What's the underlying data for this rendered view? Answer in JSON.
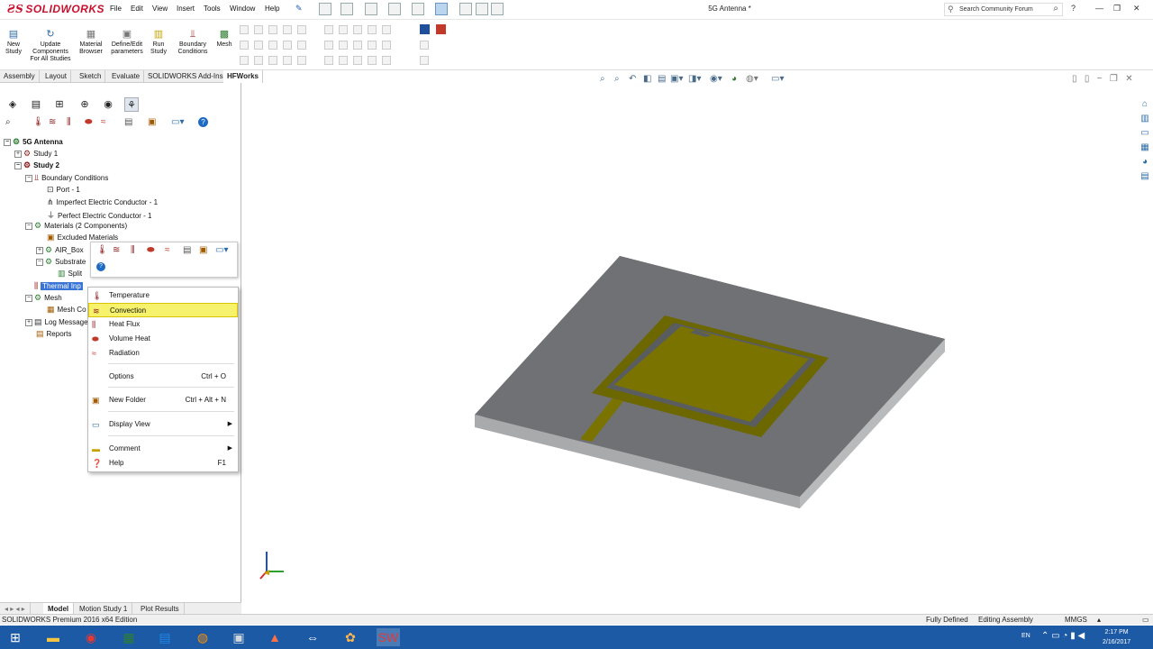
{
  "app": {
    "name": "SOLIDWORKS",
    "doc_title": "5G Antenna *"
  },
  "menu": [
    "File",
    "Edit",
    "View",
    "Insert",
    "Tools",
    "Window",
    "Help"
  ],
  "search": {
    "placeholder": "Search Community Forum"
  },
  "command_bar": [
    {
      "label": "New Study",
      "icon": "new-study-icon"
    },
    {
      "label": "Update Components For All Studies",
      "icon": "update-icon"
    },
    {
      "label": "Material Browser",
      "icon": "material-icon"
    },
    {
      "label": "Define/Edit parameters",
      "icon": "parameters-icon"
    },
    {
      "label": "Run Study",
      "icon": "run-icon"
    },
    {
      "label": "Boundary Conditions",
      "icon": "boundary-icon"
    },
    {
      "label": "Mesh",
      "icon": "mesh-icon"
    }
  ],
  "tabs": [
    "Assembly",
    "Layout",
    "Sketch",
    "Evaluate",
    "SOLIDWORKS Add-Ins",
    "HFWorks"
  ],
  "active_tab": "HFWorks",
  "tree": {
    "root": "5G Antenna",
    "items": [
      {
        "label": "Study 1"
      },
      {
        "label": "Study 2"
      },
      {
        "label": "Boundary Conditions"
      },
      {
        "label": "Port - 1"
      },
      {
        "label": "Imperfect Electric Conductor - 1"
      },
      {
        "label": "Perfect Electric Conductor - 1"
      },
      {
        "label": "Materials    (2 Components)"
      },
      {
        "label": "Excluded Materials"
      },
      {
        "label": "AIR_Box"
      },
      {
        "label": "Substrate"
      },
      {
        "label": "Split"
      },
      {
        "label": "Thermal Inp"
      },
      {
        "label": "Mesh"
      },
      {
        "label": "Mesh Co"
      },
      {
        "label": "Log Message"
      },
      {
        "label": "Reports"
      }
    ]
  },
  "context_menu": {
    "items": [
      {
        "label": "Temperature",
        "icon": "temperature-icon"
      },
      {
        "label": "Convection",
        "icon": "convection-icon",
        "selected": true
      },
      {
        "label": "Heat Flux",
        "icon": "heat-flux-icon"
      },
      {
        "label": "Volume Heat",
        "icon": "volume-heat-icon"
      },
      {
        "label": "Radiation",
        "icon": "radiation-icon"
      },
      {
        "label": "Options",
        "shortcut": "Ctrl + O"
      },
      {
        "label": "New Folder",
        "shortcut": "Ctrl + Alt + N",
        "icon": "new-folder-icon"
      },
      {
        "label": "Display View",
        "submenu": true
      },
      {
        "label": "Comment",
        "submenu": true,
        "icon": "comment-icon"
      },
      {
        "label": "Help",
        "shortcut": "F1",
        "icon": "help-icon"
      }
    ]
  },
  "bottom_tabs": [
    "Model",
    "Motion Study 1",
    "Plot Results"
  ],
  "status": {
    "edition": "SOLIDWORKS Premium 2016 x64 Edition",
    "defined": "Fully Defined",
    "mode": "Editing Assembly",
    "units": "MMGS"
  },
  "clock": {
    "time": "2:17 PM",
    "date": "2/16/2017",
    "lang": "EN"
  },
  "colors": {
    "accent": "#c8102e",
    "highlight": "#f6f26b",
    "taskbar": "#1c5aa6",
    "substrate": "#6e7073",
    "patch": "#7b7300"
  }
}
